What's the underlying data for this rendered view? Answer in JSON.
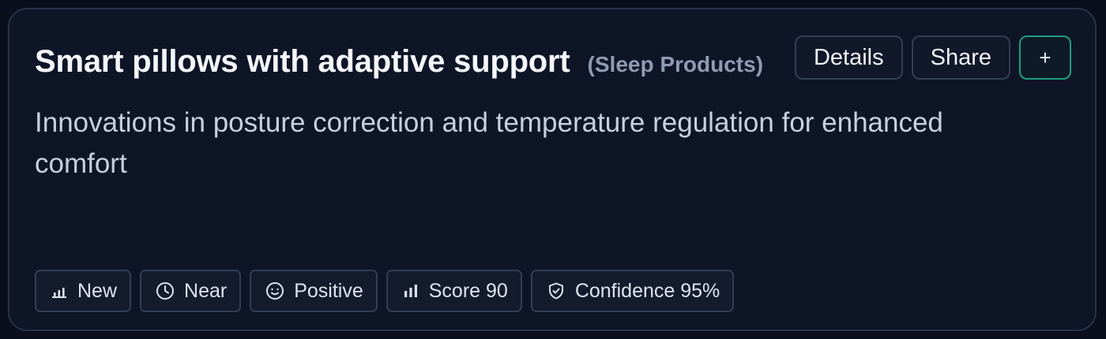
{
  "card": {
    "title": "Smart pillows with adaptive support",
    "category": "(Sleep Products)",
    "description": "Innovations in posture correction and temperature regulation for enhanced comfort"
  },
  "actions": {
    "details_label": "Details",
    "share_label": "Share",
    "add_label": "+"
  },
  "chips": [
    {
      "icon": "bar-chart-low-icon",
      "label": "New"
    },
    {
      "icon": "clock-icon",
      "label": "Near"
    },
    {
      "icon": "smile-icon",
      "label": "Positive"
    },
    {
      "icon": "bar-chart-icon",
      "label": "Score 90"
    },
    {
      "icon": "shield-check-icon",
      "label": "Confidence 95%"
    }
  ],
  "colors": {
    "background": "#0a0f1c",
    "card": "#0e1527",
    "accent": "#1f9e7c"
  }
}
